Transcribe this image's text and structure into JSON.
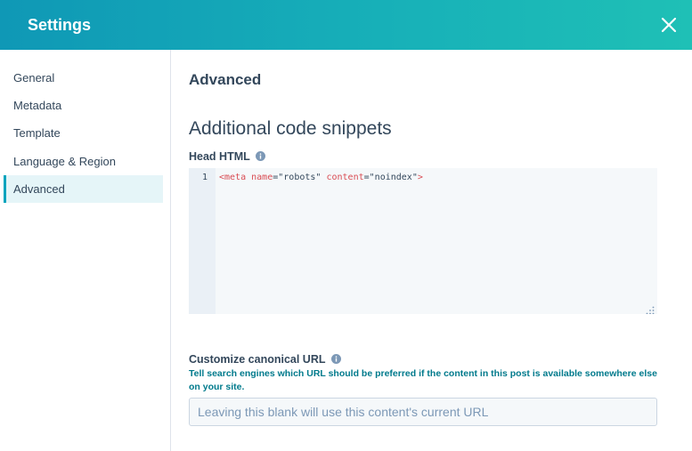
{
  "header": {
    "title": "Settings"
  },
  "sidebar": {
    "items": [
      {
        "label": "General",
        "active": false
      },
      {
        "label": "Metadata",
        "active": false
      },
      {
        "label": "Template",
        "active": false
      },
      {
        "label": "Language & Region",
        "active": false
      },
      {
        "label": "Advanced",
        "active": true
      }
    ]
  },
  "main": {
    "section_title": "Advanced",
    "subsection_title": "Additional code snippets",
    "head_html": {
      "label": "Head HTML",
      "line_number": "1",
      "code": {
        "open": "<meta",
        "attr1": "name",
        "eq1": "=",
        "val1": "\"robots\"",
        "attr2": "content",
        "eq2": "=",
        "val2": "\"noindex\"",
        "close": ">"
      }
    },
    "canonical": {
      "label": "Customize canonical URL",
      "help": "Tell search engines which URL should be preferred if the content in this post is available somewhere else on your site.",
      "value": "",
      "placeholder": "Leaving this blank will use this content's current URL"
    }
  },
  "colors": {
    "accent": "#00a4bd",
    "header_start": "#0f98b6",
    "header_end": "#1fc0b6",
    "text": "#33475b",
    "help_text": "#007a8c",
    "code_tag": "#d94c53"
  },
  "icons": {
    "close": "close-icon",
    "info": "info-icon",
    "resize": "resize-handle-icon"
  }
}
